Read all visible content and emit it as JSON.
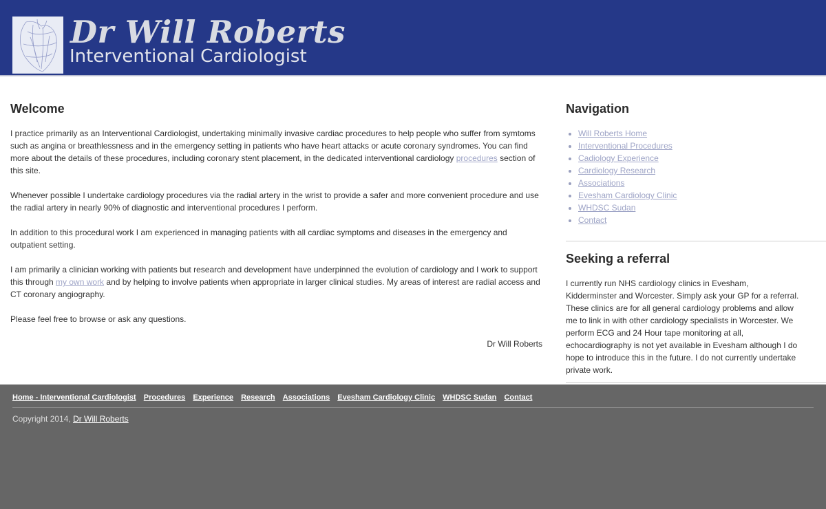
{
  "header": {
    "site_name": "Dr Will Roberts",
    "tagline": "Interventional Cardiologist",
    "logo_icon": "heart-sketch-icon",
    "background_color": "#253888"
  },
  "main": {
    "heading": "Welcome",
    "p1_text_a": "I practice primarily as an Interventional Cardiologist, undertaking minimally invasive cardiac procedures to help people who suffer from symtoms such as angina or breathlessness and in the emergency setting in patients who have heart attacks or acute coronary syndromes. You can find more about the details of these procedures, including coronary stent placement, in the dedicated interventional cardiology ",
    "p1_link": "procedures",
    "p1_text_b": " section of this site.",
    "p2": "Whenever possible I undertake cardiology procedures via the radial artery in the wrist to provide a safer and more convenient procedure and use the radial artery in nearly 90% of diagnostic and interventional procedures I perform.",
    "p3": "In addition to this procedural work I am experienced in managing patients with all cardiac symptoms and diseases in the emergency and outpatient setting.",
    "p4_text_a": "I am primarily a clinician working with patients but research and development have underpinned the evolution of cardiology and I work to support this through ",
    "p4_link": "my own work",
    "p4_text_b": " and by helping to involve patients when appropriate in larger clinical studies. My areas of interest are radial access and CT coronary angiography.",
    "p5": "Please feel free to browse or ask any questions.",
    "signature": "Dr Will Roberts",
    "link_color": "#9ea4c6"
  },
  "sidebar": {
    "nav_heading": "Navigation",
    "nav_items": [
      "Will Roberts Home",
      "Interventional Procedures",
      "Cadiology Experience",
      "Cardiology Research",
      "Associations",
      "Evesham Cardiology Clinic",
      "WHDSC Sudan",
      "Contact"
    ],
    "referral_heading": "Seeking a referral",
    "referral_text": "I currently run NHS cardiology clinics in Evesham, Kidderminster and Worcester. Simply ask your GP for a referral. These clinics are for all general cardiology problems and allow me to link in with other cardiology specialists in Worcester. We perform ECG and 24 Hour tape monitoring at all, echocardiography is not yet available in Evesham although I do hope to introduce this in the future. I do not currently undertake private work."
  },
  "footer": {
    "links": [
      "Home - Interventional Cardiologist",
      "Procedures",
      "Experience",
      "Research",
      "Associations",
      "Evesham Cardiology Clinic",
      "WHDSC Sudan",
      "Contact"
    ],
    "copyright_prefix": "Copyright 2014, ",
    "copyright_link": "Dr Will Roberts",
    "background_color": "#666666"
  }
}
